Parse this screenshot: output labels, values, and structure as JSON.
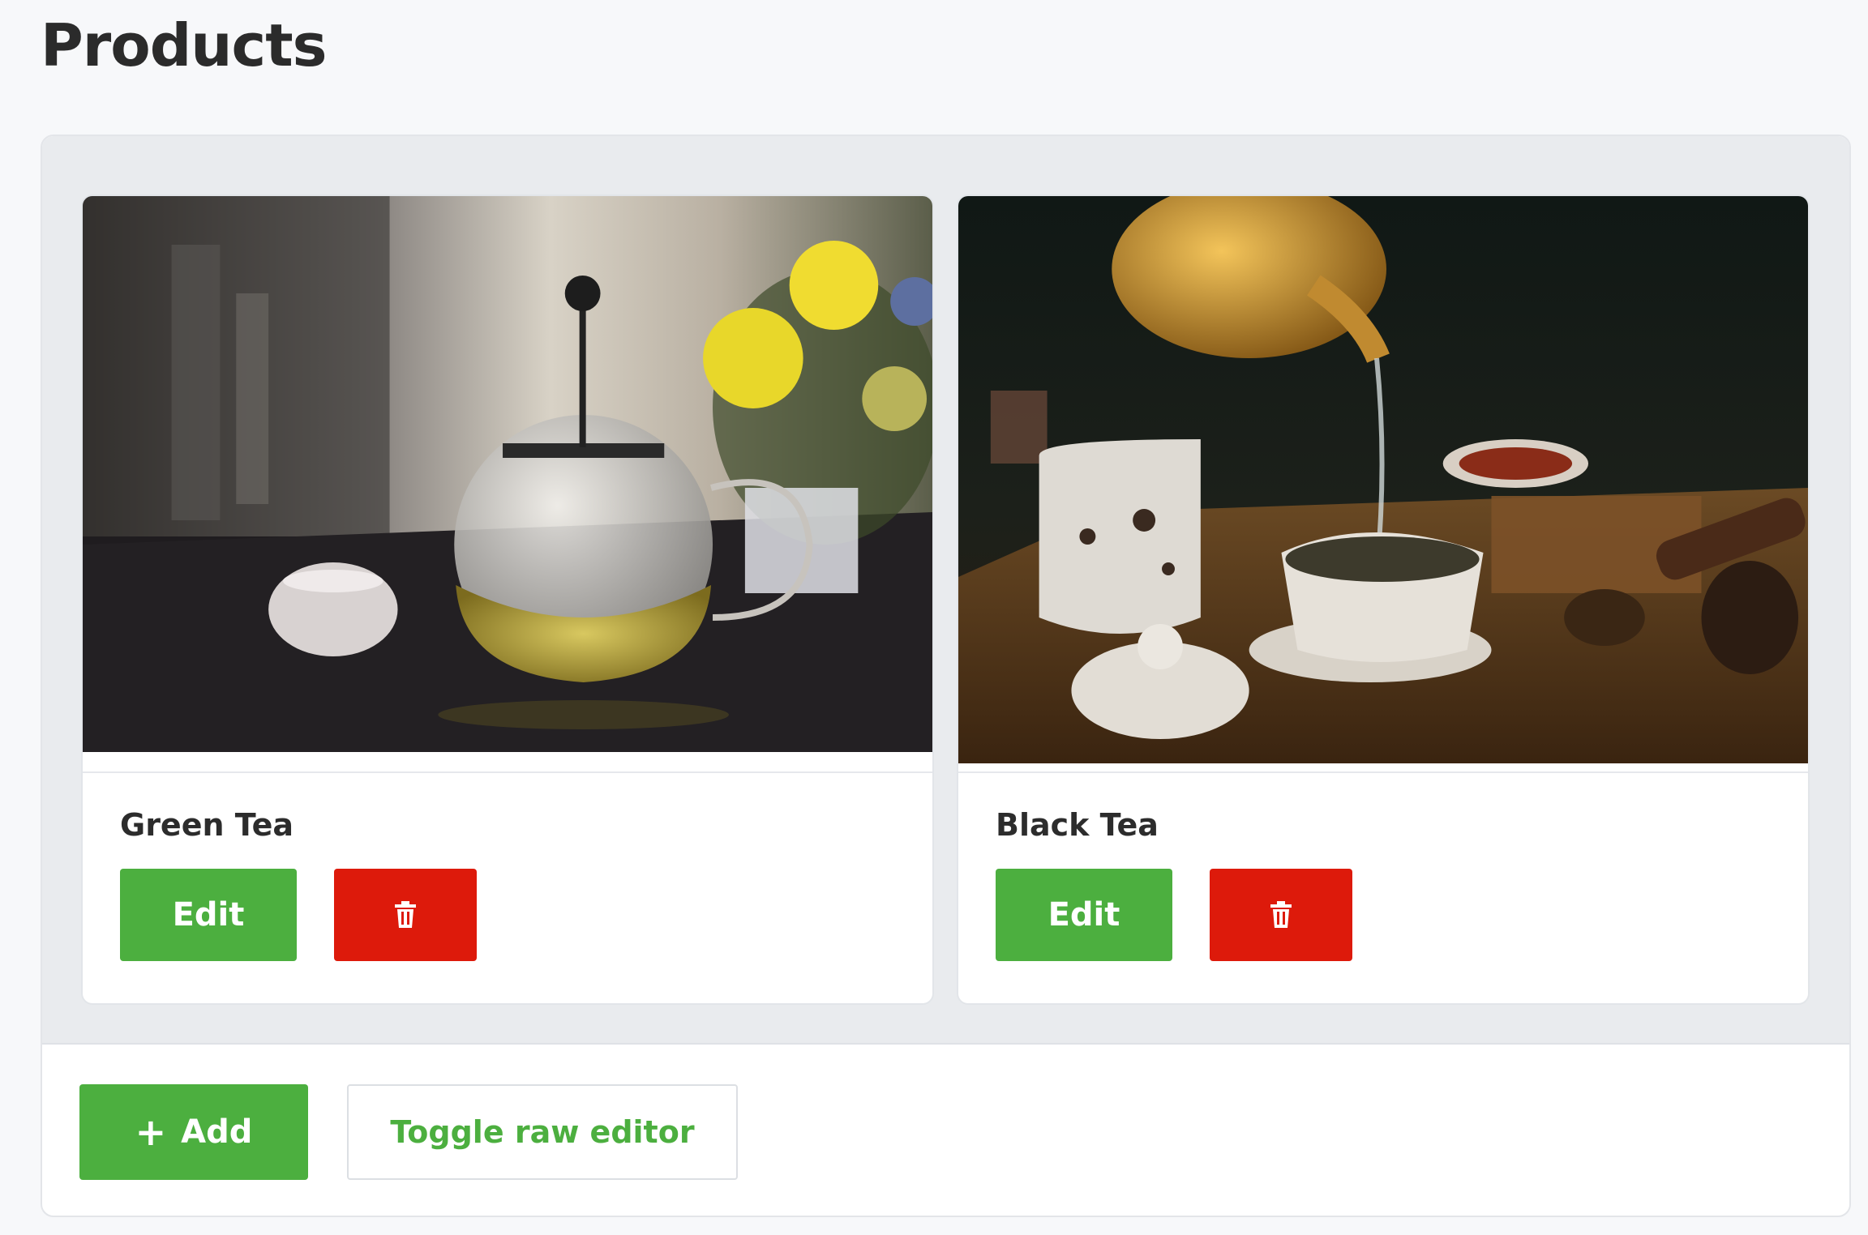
{
  "page": {
    "title": "Products"
  },
  "products": [
    {
      "name": "Green Tea",
      "edit_label": "Edit"
    },
    {
      "name": "Black Tea",
      "edit_label": "Edit"
    }
  ],
  "footer": {
    "add_icon": "+",
    "add_label": "Add",
    "toggle_label": "Toggle raw editor"
  },
  "colors": {
    "primary_green": "#4caf3f",
    "danger_red": "#dd1a0b",
    "panel_bg": "#e9ebee"
  },
  "icons": {
    "delete": "trash-icon",
    "add": "plus-icon"
  }
}
